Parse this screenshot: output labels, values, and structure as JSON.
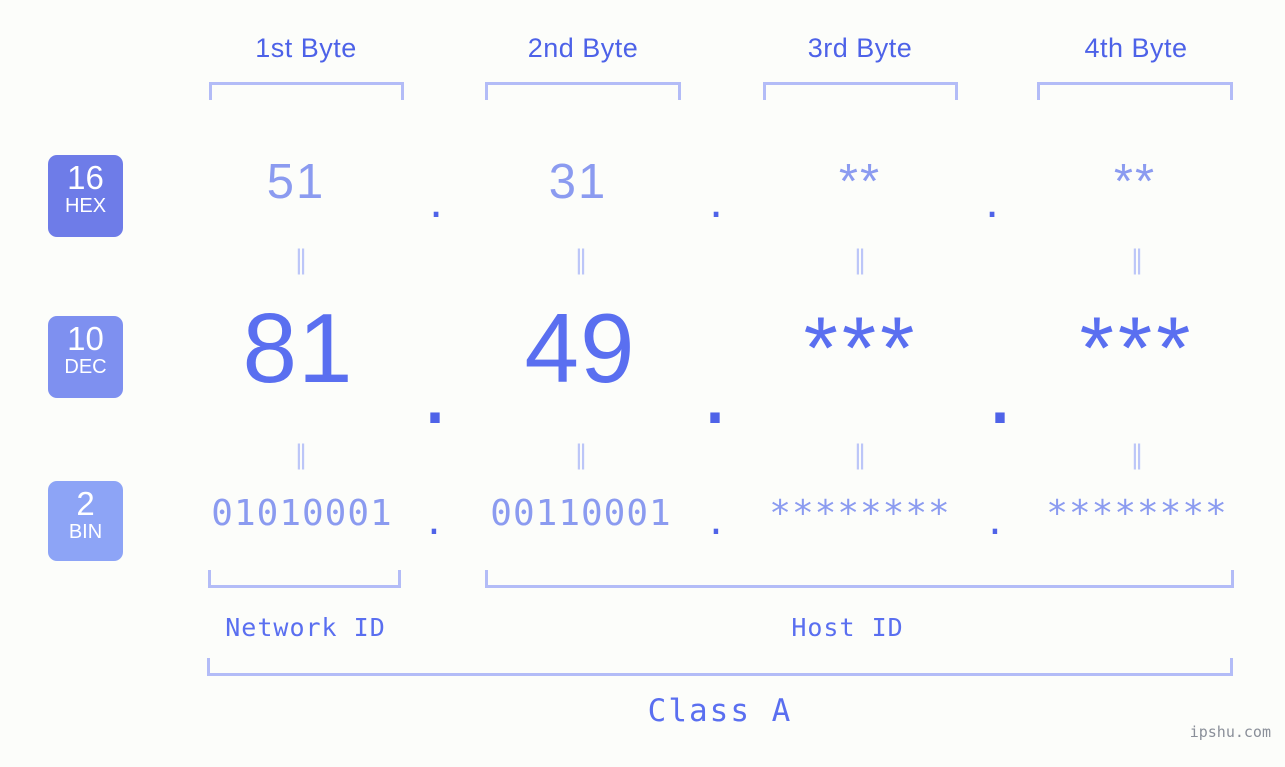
{
  "meta": {
    "background_color": "#fcfdfa",
    "accent_color": "#5a6ff0",
    "light_accent_color": "#8b9bf0",
    "bracket_color": "#b3bcf7",
    "watermark": "ipshu.com"
  },
  "headers": {
    "bytes": [
      {
        "label": "1st Byte"
      },
      {
        "label": "2nd Byte"
      },
      {
        "label": "3rd Byte"
      },
      {
        "label": "4th Byte"
      }
    ]
  },
  "rows": {
    "hex": {
      "badge_number": "16",
      "badge_abbr": "HEX",
      "badge_color": "#6e7ce8",
      "values": [
        "51",
        "31",
        "**",
        "**"
      ],
      "separator": "."
    },
    "dec": {
      "badge_number": "10",
      "badge_abbr": "DEC",
      "badge_color": "#7e90f0",
      "values": [
        "81",
        "49",
        "***",
        "***"
      ],
      "separator": "."
    },
    "bin": {
      "badge_number": "2",
      "badge_abbr": "BIN",
      "badge_color": "#8da4f6",
      "values": [
        "01010001",
        "00110001",
        "********",
        "********"
      ],
      "separator": "."
    }
  },
  "equal_marks": {
    "glyph": "‖",
    "count_per_row": 4
  },
  "segments": {
    "network_id_label": "Network ID",
    "host_id_label": "Host ID",
    "class_label": "Class A"
  }
}
